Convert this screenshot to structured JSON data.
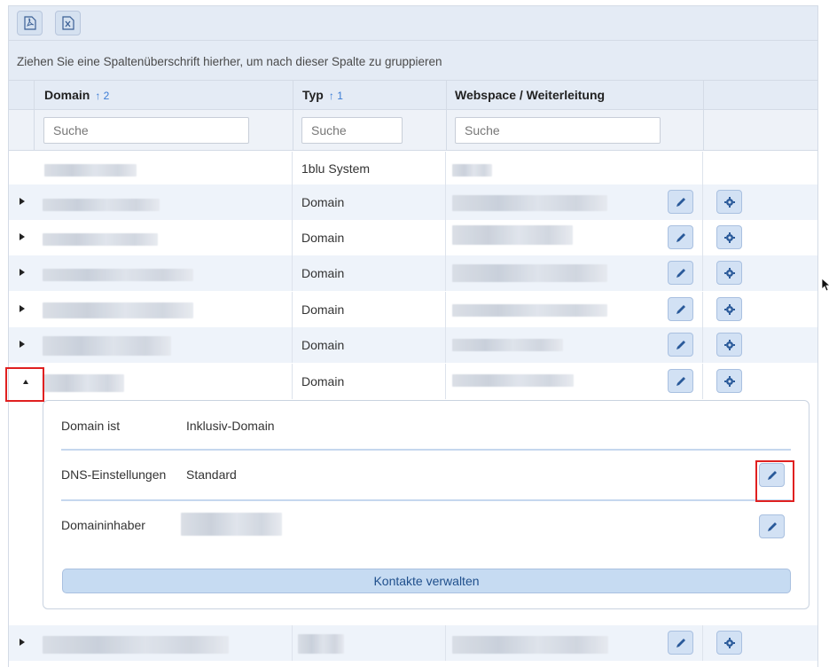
{
  "toolbar": {
    "pdf_icon": "pdf-export-icon",
    "excel_icon": "excel-export-icon"
  },
  "group_panel": {
    "text": "Ziehen Sie eine Spaltenüberschrift hierher, um nach dieser Spalte zu gruppieren"
  },
  "columns": [
    {
      "label": "Domain",
      "sort": "↑ 2"
    },
    {
      "label": "Typ",
      "sort": "↑ 1"
    },
    {
      "label": "Webspace / Weiterleitung",
      "sort": ""
    }
  ],
  "filters": {
    "domain_placeholder": "Suche",
    "typ_placeholder": "Suche",
    "webspace_placeholder": "Suche"
  },
  "rows": [
    {
      "typ": "1blu System",
      "expandable": false,
      "actions": false
    },
    {
      "typ": "Domain",
      "expandable": true,
      "actions": true
    },
    {
      "typ": "Domain",
      "expandable": true,
      "actions": true
    },
    {
      "typ": "Domain",
      "expandable": true,
      "actions": true
    },
    {
      "typ": "Domain",
      "expandable": true,
      "actions": true
    },
    {
      "typ": "Domain",
      "expandable": true,
      "actions": true
    },
    {
      "typ": "Domain",
      "expandable": true,
      "expanded": true,
      "actions": true
    },
    {
      "typ": "",
      "expandable": true,
      "actions": true
    }
  ],
  "detail": {
    "domain_ist_label": "Domain ist",
    "domain_ist_value": "Inklusiv-Domain",
    "dns_label": "DNS-Einstellungen",
    "dns_value": "Standard",
    "inhaber_label": "Domaininhaber",
    "kontakte_button": "Kontakte verwalten"
  },
  "colors": {
    "accent": "#3a7bd5",
    "header_bg": "#e4ebf5",
    "button_bg": "#d2e1f4",
    "highlight": "#e02020"
  }
}
